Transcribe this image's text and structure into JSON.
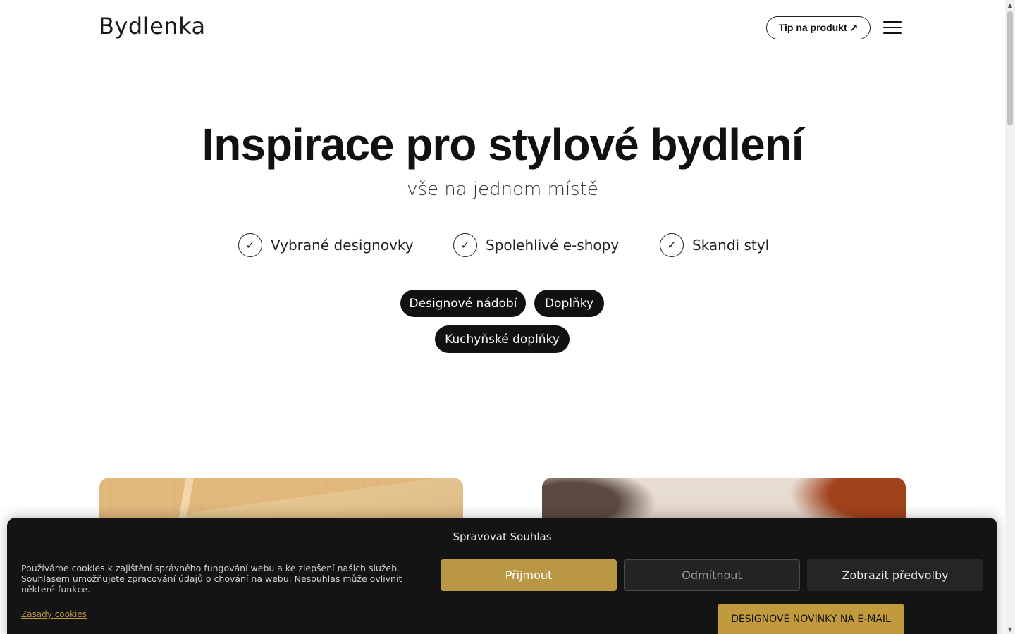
{
  "header": {
    "logo": "Bydlenka",
    "tip_button": "Tip na produkt ↗",
    "menu_icon": "hamburger-icon"
  },
  "hero": {
    "title": "Inspirace pro stylové bydlení",
    "subtitle": "vše na jednom místě",
    "features": [
      {
        "icon": "check-icon",
        "check": "✓",
        "label": "Vybrané designovky"
      },
      {
        "icon": "check-icon",
        "check": "✓",
        "label": "Spolehlivé e-shopy"
      },
      {
        "icon": "check-icon",
        "check": "✓",
        "label": "Skandi styl"
      }
    ],
    "categories": [
      "Designové nádobí",
      "Doplňky",
      "Kuchyňské doplňky"
    ]
  },
  "cookie": {
    "title": "Spravovat Souhlas",
    "text": "Používáme cookies k zajištění správného fungování webu a ke zlepšení našich služeb. Souhlasem umožňujete zpracování údajů o chování na webu. Nesouhlas může ovlivnit některé funkce.",
    "accept": "Přijmout",
    "deny": "Odmítnout",
    "preferences": "Zobrazit předvolby",
    "policy_link": "Zásady cookies"
  },
  "newsletter": {
    "label": "DESIGNOVÉ NOVINKY NA E-MAIL"
  },
  "colors": {
    "accent_gold": "#b99745",
    "pill_bg": "#111111",
    "banner_bg": "#141414"
  },
  "scrollbar": {
    "up_arrow": "▲",
    "down_arrow": "▼"
  }
}
